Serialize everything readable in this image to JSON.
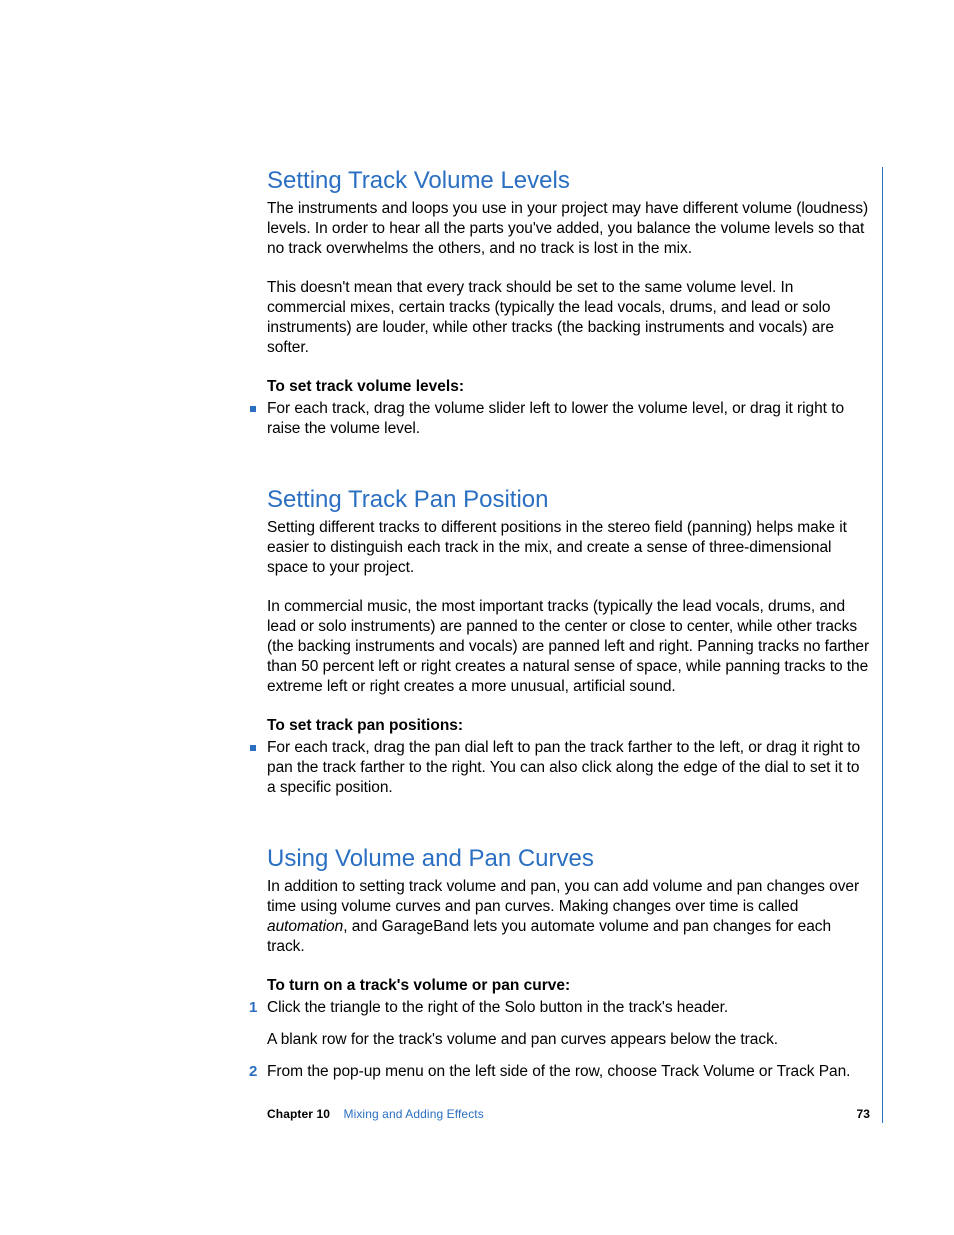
{
  "sections": [
    {
      "heading": "Setting Track Volume Levels",
      "paragraphs": [
        "The instruments and loops you use in your project may have different volume (loudness) levels. In order to hear all the parts you've added, you balance the volume levels so that no track overwhelms the others, and no track is lost in the mix.",
        "This doesn't mean that every track should be set to the same volume level. In commercial mixes, certain tracks (typically the lead vocals, drums, and lead or solo instruments) are louder, while other tracks (the backing instruments and vocals) are softer."
      ],
      "subhead": "To set track volume levels:",
      "bullets": [
        "For each track, drag the volume slider left to lower the volume level, or drag it right to raise the volume level."
      ]
    },
    {
      "heading": "Setting Track Pan Position",
      "paragraphs": [
        "Setting different tracks to different positions in the stereo field (panning) helps make it easier to distinguish each track in the mix, and create a sense of three-dimensional space to your project.",
        "In commercial music, the most important tracks (typically the lead vocals, drums, and lead or solo instruments) are panned to the center or close to center, while other tracks (the backing instruments and vocals) are panned left and right. Panning tracks no farther than 50 percent left or right creates a natural sense of space, while panning tracks to the extreme left or right creates a more unusual, artificial sound."
      ],
      "subhead": "To set track pan positions:",
      "bullets": [
        "For each track, drag the pan dial left to pan the track farther to the left, or drag it right to pan the track farther to the right. You can also click along the edge of the dial to set it to a specific position."
      ]
    },
    {
      "heading": "Using Volume and Pan Curves",
      "intro_html": "In addition to setting track volume and pan, you can add volume and pan changes over time using volume curves and pan curves. Making changes over time is called <em>automation</em>, and GarageBand lets you automate volume and pan changes for each track.",
      "subhead": "To turn on a track's volume or pan curve:",
      "steps": [
        {
          "num": "1",
          "text": "Click the triangle to the right of the Solo button in the track's header.",
          "after": "A blank row for the track's volume and pan curves appears below the track."
        },
        {
          "num": "2",
          "text": "From the pop-up menu on the left side of the row, choose Track Volume or Track Pan."
        }
      ]
    }
  ],
  "footer": {
    "chapter_label": "Chapter 10",
    "chapter_title": "Mixing and Adding Effects",
    "page_number": "73"
  }
}
